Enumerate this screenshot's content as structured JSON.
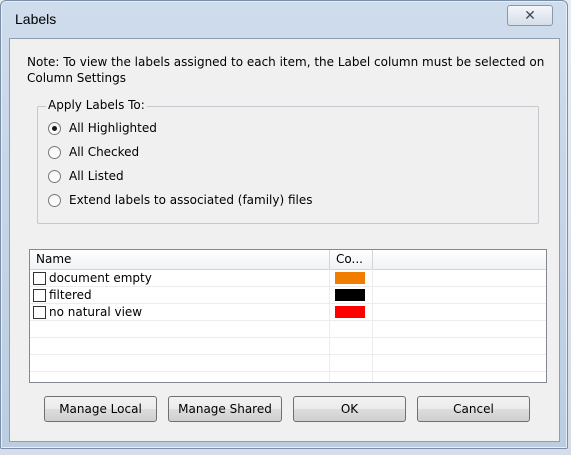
{
  "dialog": {
    "title": "Labels",
    "close_glyph": "✕"
  },
  "note": "Note: To view the labels assigned to each item, the Label column must be selected on Column Settings",
  "apply_group": {
    "legend": "Apply Labels To:",
    "options": [
      {
        "label": "All Highlighted",
        "checked": true
      },
      {
        "label": "All Checked",
        "checked": false
      },
      {
        "label": "All Listed",
        "checked": false
      },
      {
        "label": "Extend labels to associated (family) files",
        "checked": false
      }
    ]
  },
  "labels_table": {
    "columns": [
      "Name",
      "Co..."
    ],
    "rows": [
      {
        "name": "document empty",
        "color": "#f07d00",
        "checked": false
      },
      {
        "name": "filtered",
        "color": "#000000",
        "checked": false
      },
      {
        "name": "no natural view",
        "color": "#ff0000",
        "checked": false
      }
    ]
  },
  "buttons": {
    "manage_local": "Manage Local",
    "manage_shared": "Manage Shared",
    "ok": "OK",
    "cancel": "Cancel"
  }
}
